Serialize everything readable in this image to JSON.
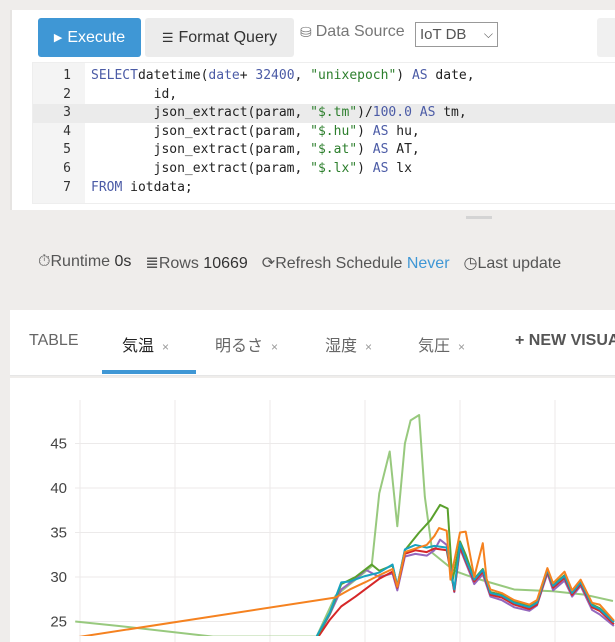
{
  "toolbar": {
    "execute_label": "Execute",
    "format_label": "Format Query",
    "datasource_label": "Data Source",
    "datasource_value": "IoT DB"
  },
  "editor": {
    "highlighted_line": 3,
    "lines": [
      [
        [
          "kw",
          "SELECT"
        ],
        [
          "",
          "datetime("
        ],
        [
          "kw",
          "date"
        ],
        [
          "",
          "+ "
        ],
        [
          "num",
          "32400"
        ],
        [
          "",
          ", "
        ],
        [
          "str",
          "\"unixepoch\""
        ],
        [
          "",
          ") "
        ],
        [
          "kw",
          "AS"
        ],
        [
          "",
          " date,"
        ]
      ],
      [
        [
          "",
          "        id,"
        ]
      ],
      [
        [
          "",
          "        json_extract(param, "
        ],
        [
          "str",
          "\"$.tm\""
        ],
        [
          "",
          ")/"
        ],
        [
          "num",
          "100.0"
        ],
        [
          "",
          " "
        ],
        [
          "kw",
          "AS"
        ],
        [
          "",
          " tm,"
        ]
      ],
      [
        [
          "",
          "        json_extract(param, "
        ],
        [
          "str",
          "\"$.hu\""
        ],
        [
          "",
          ") "
        ],
        [
          "kw",
          "AS"
        ],
        [
          "",
          " hu,"
        ]
      ],
      [
        [
          "",
          "        json_extract(param, "
        ],
        [
          "str",
          "\"$.at\""
        ],
        [
          "",
          ") "
        ],
        [
          "kw",
          "AS"
        ],
        [
          "",
          " AT,"
        ]
      ],
      [
        [
          "",
          "        json_extract(param, "
        ],
        [
          "str",
          "\"$.lx\""
        ],
        [
          "",
          ") "
        ],
        [
          "kw",
          "AS"
        ],
        [
          "",
          " lx"
        ]
      ],
      [
        [
          "kw",
          "FROM"
        ],
        [
          "",
          " iotdata;"
        ]
      ]
    ]
  },
  "stats": {
    "runtime_label": "Runtime",
    "runtime_value": "0s",
    "rows_label": "Rows",
    "rows_value": "10669",
    "refresh_label": "Refresh Schedule",
    "refresh_value": "Never",
    "last_update_label": "Last update"
  },
  "tabs": [
    {
      "label": "TABLE"
    },
    {
      "label": "気温",
      "close": "×",
      "active": true
    },
    {
      "label": "明るさ",
      "close": "×"
    },
    {
      "label": "湿度",
      "close": "×"
    },
    {
      "label": "気圧",
      "close": "×"
    },
    {
      "label": "+ NEW VISUA"
    }
  ],
  "chart_data": {
    "type": "line",
    "grid": true,
    "ylim": [
      23,
      49
    ],
    "yticks": [
      "25",
      "30",
      "35",
      "40",
      "45"
    ],
    "series": [
      {
        "color": "#98c97e",
        "points": [
          [
            -0.05,
            25
          ],
          [
            0.41,
            24.5
          ],
          [
            1.4,
            23.3
          ],
          [
            2.49,
            23.3
          ],
          [
            2.69,
            27.9
          ],
          [
            2.9,
            29.7
          ],
          [
            3.07,
            31.2
          ],
          [
            3.15,
            39.4
          ],
          [
            3.26,
            44.1
          ],
          [
            3.34,
            35.7
          ],
          [
            3.42,
            45
          ],
          [
            3.48,
            47.6
          ],
          [
            3.57,
            48.2
          ],
          [
            3.63,
            39
          ],
          [
            3.71,
            32.7
          ],
          [
            3.94,
            30.7
          ],
          [
            4.15,
            29.9
          ],
          [
            4.57,
            28.6
          ],
          [
            4.98,
            28.4
          ],
          [
            5.32,
            28
          ],
          [
            5.61,
            27.3
          ]
        ]
      },
      {
        "color": "#9467bd",
        "points": [
          [
            2.49,
            23.1
          ],
          [
            2.63,
            25.8
          ],
          [
            2.75,
            28.6
          ],
          [
            2.9,
            29.8
          ],
          [
            3.01,
            30.8
          ],
          [
            3.15,
            30
          ],
          [
            3.29,
            30.4
          ],
          [
            3.34,
            28.5
          ],
          [
            3.42,
            32.3
          ],
          [
            3.53,
            32.6
          ],
          [
            3.65,
            32.4
          ],
          [
            3.73,
            33
          ],
          [
            3.79,
            34.2
          ],
          [
            3.86,
            33.6
          ],
          [
            3.94,
            28.3
          ],
          [
            4.0,
            33.2
          ],
          [
            4.06,
            31.6
          ],
          [
            4.15,
            29.2
          ],
          [
            4.24,
            30.3
          ],
          [
            4.32,
            27.8
          ],
          [
            4.44,
            27.4
          ],
          [
            4.57,
            26.6
          ],
          [
            4.73,
            26.2
          ],
          [
            4.81,
            26.8
          ],
          [
            4.92,
            30.4
          ],
          [
            4.98,
            28.5
          ],
          [
            5.1,
            29.6
          ],
          [
            5.18,
            27.8
          ],
          [
            5.27,
            29
          ],
          [
            5.39,
            26.3
          ],
          [
            5.47,
            25.8
          ],
          [
            5.62,
            24.5
          ]
        ]
      },
      {
        "color": "#d62728",
        "points": [
          [
            2.49,
            23
          ],
          [
            2.63,
            25.2
          ],
          [
            2.75,
            26.7
          ],
          [
            2.9,
            27.8
          ],
          [
            3.0,
            28.6
          ],
          [
            3.15,
            29.8
          ],
          [
            3.29,
            30.6
          ],
          [
            3.34,
            28.8
          ],
          [
            3.42,
            32.6
          ],
          [
            3.53,
            33
          ],
          [
            3.65,
            32.8
          ],
          [
            3.73,
            33.2
          ],
          [
            3.86,
            33
          ],
          [
            3.94,
            28.4
          ],
          [
            4.0,
            33.4
          ],
          [
            4.06,
            31.8
          ],
          [
            4.15,
            29.5
          ],
          [
            4.24,
            30.6
          ],
          [
            4.32,
            28
          ],
          [
            4.44,
            27.7
          ],
          [
            4.57,
            26.9
          ],
          [
            4.73,
            26.4
          ],
          [
            4.81,
            26.9
          ],
          [
            4.92,
            30.6
          ],
          [
            4.98,
            28.8
          ],
          [
            5.1,
            29.9
          ],
          [
            5.18,
            28
          ],
          [
            5.27,
            29.2
          ],
          [
            5.39,
            26.6
          ],
          [
            5.47,
            26.2
          ],
          [
            5.62,
            24.7
          ]
        ]
      },
      {
        "color": "#5aa02c",
        "points": [
          [
            2.49,
            23.2
          ],
          [
            2.63,
            25.9
          ],
          [
            2.75,
            29.2
          ],
          [
            2.9,
            30
          ],
          [
            3.07,
            31.4
          ],
          [
            3.15,
            30.7
          ],
          [
            3.29,
            31.3
          ],
          [
            3.34,
            29
          ],
          [
            3.42,
            33
          ],
          [
            3.57,
            35
          ],
          [
            3.69,
            36.4
          ],
          [
            3.79,
            38.1
          ],
          [
            3.87,
            37.7
          ],
          [
            3.92,
            29.5
          ],
          [
            4.0,
            34
          ],
          [
            4.06,
            32.5
          ],
          [
            4.15,
            29.8
          ],
          [
            4.24,
            30.9
          ],
          [
            4.32,
            28.3
          ],
          [
            4.44,
            28
          ],
          [
            4.57,
            27.2
          ],
          [
            4.73,
            26.7
          ],
          [
            4.81,
            27.2
          ],
          [
            4.92,
            30.9
          ],
          [
            4.98,
            29.1
          ],
          [
            5.1,
            30.2
          ],
          [
            5.18,
            28.3
          ],
          [
            5.27,
            29.5
          ],
          [
            5.39,
            26.9
          ],
          [
            5.47,
            26.5
          ],
          [
            5.62,
            25
          ]
        ]
      },
      {
        "color": "#17a2bf",
        "points": [
          [
            2.49,
            23.3
          ],
          [
            2.63,
            26
          ],
          [
            2.75,
            29.4
          ],
          [
            2.84,
            29.5
          ],
          [
            3.0,
            30.1
          ],
          [
            3.15,
            30.5
          ],
          [
            3.29,
            31.4
          ],
          [
            3.34,
            29
          ],
          [
            3.42,
            33.1
          ],
          [
            3.53,
            33.6
          ],
          [
            3.65,
            33.3
          ],
          [
            3.73,
            33.5
          ],
          [
            3.86,
            33.3
          ],
          [
            3.94,
            28.6
          ],
          [
            4.0,
            33.8
          ],
          [
            4.06,
            32
          ],
          [
            4.15,
            29.7
          ],
          [
            4.24,
            30.8
          ],
          [
            4.32,
            28.2
          ],
          [
            4.44,
            27.9
          ],
          [
            4.57,
            27.1
          ],
          [
            4.73,
            26.6
          ],
          [
            4.81,
            27.1
          ],
          [
            4.92,
            30.8
          ],
          [
            4.98,
            29
          ],
          [
            5.1,
            30.1
          ],
          [
            5.18,
            28.2
          ],
          [
            5.27,
            29.4
          ],
          [
            5.39,
            26.8
          ],
          [
            5.47,
            26.4
          ],
          [
            5.62,
            24.9
          ]
        ]
      },
      {
        "color": "#f58220",
        "points": [
          [
            -0.05,
            23.2
          ],
          [
            2.69,
            27.7
          ],
          [
            2.84,
            28.6
          ],
          [
            3.0,
            29.4
          ],
          [
            3.15,
            30.2
          ],
          [
            3.29,
            30.9
          ],
          [
            3.34,
            28.9
          ],
          [
            3.42,
            32.8
          ],
          [
            3.53,
            33.2
          ],
          [
            3.65,
            33.6
          ],
          [
            3.73,
            34.6
          ],
          [
            3.78,
            35.5
          ],
          [
            3.86,
            35.2
          ],
          [
            3.9,
            29.7
          ],
          [
            4.0,
            35
          ],
          [
            4.06,
            35.1
          ],
          [
            4.15,
            30
          ],
          [
            4.24,
            33.8
          ],
          [
            4.28,
            29.8
          ],
          [
            4.32,
            28.6
          ],
          [
            4.44,
            28.2
          ],
          [
            4.57,
            27.4
          ],
          [
            4.73,
            26.9
          ],
          [
            4.81,
            27.4
          ],
          [
            4.92,
            31
          ],
          [
            4.98,
            29.3
          ],
          [
            5.1,
            30.6
          ],
          [
            5.18,
            28.5
          ],
          [
            5.27,
            29.7
          ],
          [
            5.39,
            27.1
          ],
          [
            5.47,
            26.9
          ],
          [
            5.62,
            25.1
          ]
        ]
      }
    ]
  }
}
